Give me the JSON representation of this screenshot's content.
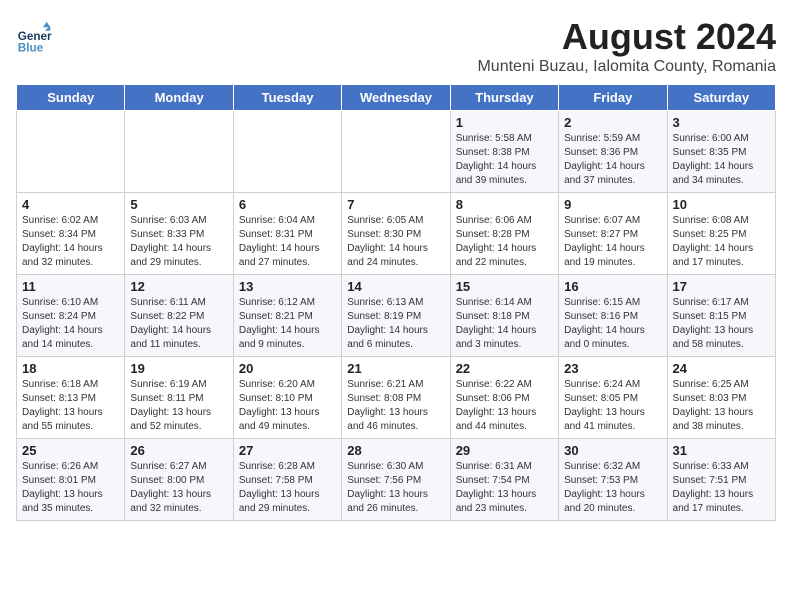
{
  "logo": {
    "text_general": "General",
    "text_blue": "Blue"
  },
  "header": {
    "title": "August 2024",
    "subtitle": "Munteni Buzau, Ialomita County, Romania"
  },
  "weekdays": [
    "Sunday",
    "Monday",
    "Tuesday",
    "Wednesday",
    "Thursday",
    "Friday",
    "Saturday"
  ],
  "weeks": [
    [
      {
        "day": "",
        "info": ""
      },
      {
        "day": "",
        "info": ""
      },
      {
        "day": "",
        "info": ""
      },
      {
        "day": "",
        "info": ""
      },
      {
        "day": "1",
        "info": "Sunrise: 5:58 AM\nSunset: 8:38 PM\nDaylight: 14 hours\nand 39 minutes."
      },
      {
        "day": "2",
        "info": "Sunrise: 5:59 AM\nSunset: 8:36 PM\nDaylight: 14 hours\nand 37 minutes."
      },
      {
        "day": "3",
        "info": "Sunrise: 6:00 AM\nSunset: 8:35 PM\nDaylight: 14 hours\nand 34 minutes."
      }
    ],
    [
      {
        "day": "4",
        "info": "Sunrise: 6:02 AM\nSunset: 8:34 PM\nDaylight: 14 hours\nand 32 minutes."
      },
      {
        "day": "5",
        "info": "Sunrise: 6:03 AM\nSunset: 8:33 PM\nDaylight: 14 hours\nand 29 minutes."
      },
      {
        "day": "6",
        "info": "Sunrise: 6:04 AM\nSunset: 8:31 PM\nDaylight: 14 hours\nand 27 minutes."
      },
      {
        "day": "7",
        "info": "Sunrise: 6:05 AM\nSunset: 8:30 PM\nDaylight: 14 hours\nand 24 minutes."
      },
      {
        "day": "8",
        "info": "Sunrise: 6:06 AM\nSunset: 8:28 PM\nDaylight: 14 hours\nand 22 minutes."
      },
      {
        "day": "9",
        "info": "Sunrise: 6:07 AM\nSunset: 8:27 PM\nDaylight: 14 hours\nand 19 minutes."
      },
      {
        "day": "10",
        "info": "Sunrise: 6:08 AM\nSunset: 8:25 PM\nDaylight: 14 hours\nand 17 minutes."
      }
    ],
    [
      {
        "day": "11",
        "info": "Sunrise: 6:10 AM\nSunset: 8:24 PM\nDaylight: 14 hours\nand 14 minutes."
      },
      {
        "day": "12",
        "info": "Sunrise: 6:11 AM\nSunset: 8:22 PM\nDaylight: 14 hours\nand 11 minutes."
      },
      {
        "day": "13",
        "info": "Sunrise: 6:12 AM\nSunset: 8:21 PM\nDaylight: 14 hours\nand 9 minutes."
      },
      {
        "day": "14",
        "info": "Sunrise: 6:13 AM\nSunset: 8:19 PM\nDaylight: 14 hours\nand 6 minutes."
      },
      {
        "day": "15",
        "info": "Sunrise: 6:14 AM\nSunset: 8:18 PM\nDaylight: 14 hours\nand 3 minutes."
      },
      {
        "day": "16",
        "info": "Sunrise: 6:15 AM\nSunset: 8:16 PM\nDaylight: 14 hours\nand 0 minutes."
      },
      {
        "day": "17",
        "info": "Sunrise: 6:17 AM\nSunset: 8:15 PM\nDaylight: 13 hours\nand 58 minutes."
      }
    ],
    [
      {
        "day": "18",
        "info": "Sunrise: 6:18 AM\nSunset: 8:13 PM\nDaylight: 13 hours\nand 55 minutes."
      },
      {
        "day": "19",
        "info": "Sunrise: 6:19 AM\nSunset: 8:11 PM\nDaylight: 13 hours\nand 52 minutes."
      },
      {
        "day": "20",
        "info": "Sunrise: 6:20 AM\nSunset: 8:10 PM\nDaylight: 13 hours\nand 49 minutes."
      },
      {
        "day": "21",
        "info": "Sunrise: 6:21 AM\nSunset: 8:08 PM\nDaylight: 13 hours\nand 46 minutes."
      },
      {
        "day": "22",
        "info": "Sunrise: 6:22 AM\nSunset: 8:06 PM\nDaylight: 13 hours\nand 44 minutes."
      },
      {
        "day": "23",
        "info": "Sunrise: 6:24 AM\nSunset: 8:05 PM\nDaylight: 13 hours\nand 41 minutes."
      },
      {
        "day": "24",
        "info": "Sunrise: 6:25 AM\nSunset: 8:03 PM\nDaylight: 13 hours\nand 38 minutes."
      }
    ],
    [
      {
        "day": "25",
        "info": "Sunrise: 6:26 AM\nSunset: 8:01 PM\nDaylight: 13 hours\nand 35 minutes."
      },
      {
        "day": "26",
        "info": "Sunrise: 6:27 AM\nSunset: 8:00 PM\nDaylight: 13 hours\nand 32 minutes."
      },
      {
        "day": "27",
        "info": "Sunrise: 6:28 AM\nSunset: 7:58 PM\nDaylight: 13 hours\nand 29 minutes."
      },
      {
        "day": "28",
        "info": "Sunrise: 6:30 AM\nSunset: 7:56 PM\nDaylight: 13 hours\nand 26 minutes."
      },
      {
        "day": "29",
        "info": "Sunrise: 6:31 AM\nSunset: 7:54 PM\nDaylight: 13 hours\nand 23 minutes."
      },
      {
        "day": "30",
        "info": "Sunrise: 6:32 AM\nSunset: 7:53 PM\nDaylight: 13 hours\nand 20 minutes."
      },
      {
        "day": "31",
        "info": "Sunrise: 6:33 AM\nSunset: 7:51 PM\nDaylight: 13 hours\nand 17 minutes."
      }
    ]
  ]
}
